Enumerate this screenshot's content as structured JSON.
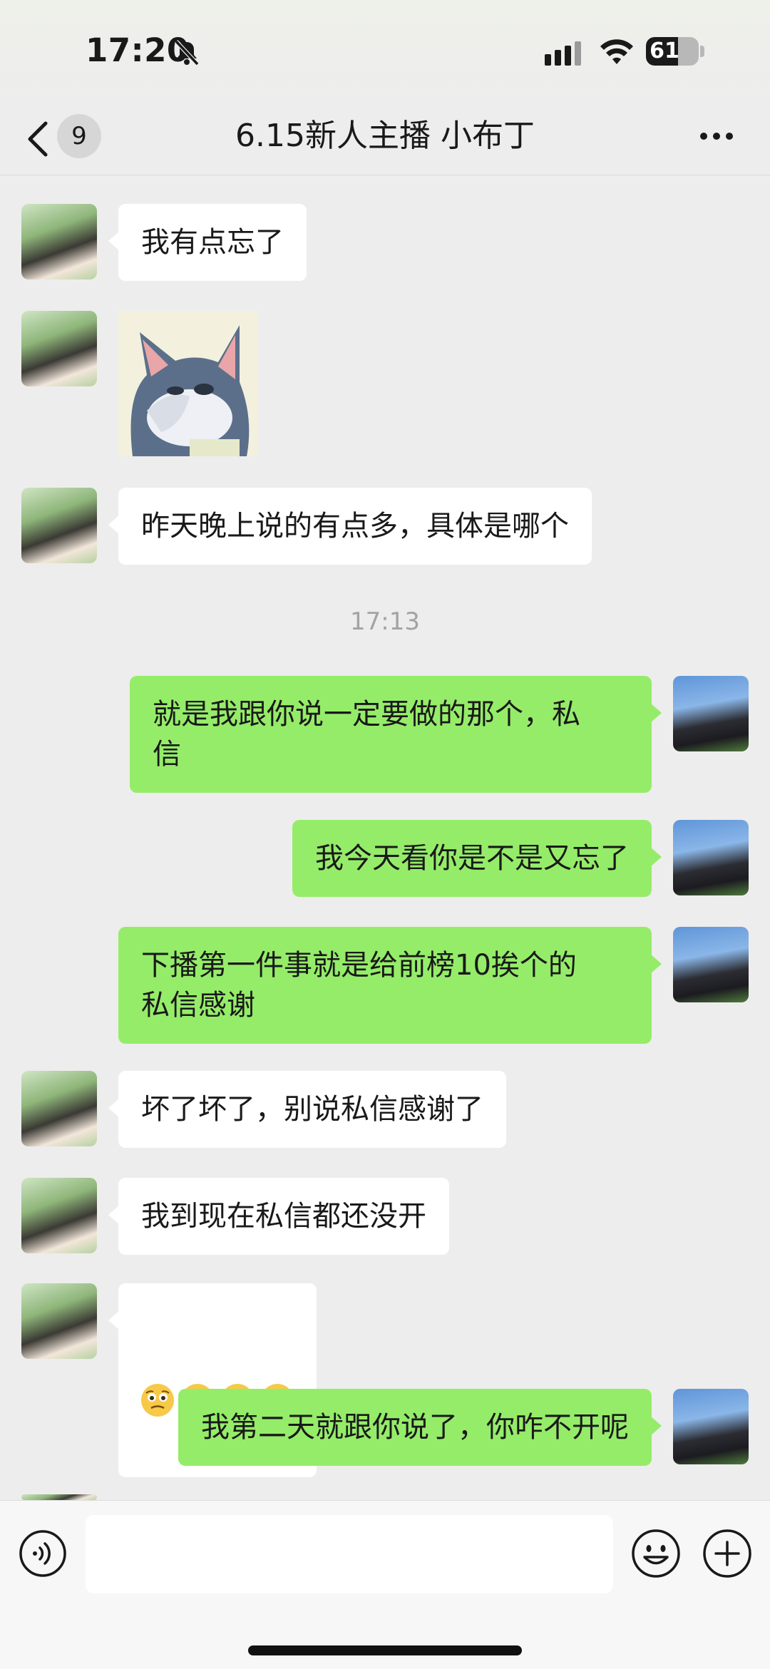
{
  "status_bar": {
    "time": "17:20",
    "battery": "61",
    "battery_level": 0.61
  },
  "header": {
    "unread_count": "9",
    "title": "6.15新人主播  小布丁"
  },
  "timestamp": "17:13",
  "messages": [
    {
      "from": "her",
      "type": "text",
      "text": "我有点忘了"
    },
    {
      "from": "her",
      "type": "sticker",
      "icon": "tom-cat-sticker"
    },
    {
      "from": "her",
      "type": "text",
      "text": "昨天晚上说的有点多，具体是哪个"
    },
    {
      "from": "me",
      "type": "text",
      "text": "就是我跟你说一定要做的那个，私\n信"
    },
    {
      "from": "me",
      "type": "text",
      "text": "我今天看你是不是又忘了"
    },
    {
      "from": "me",
      "type": "text",
      "text": "下播第一件事就是给前榜10挨个的\n私信感谢"
    },
    {
      "from": "her",
      "type": "text",
      "text": "坏了坏了，别说私信感谢了"
    },
    {
      "from": "her",
      "type": "text",
      "text": "我到现在私信都还没开"
    },
    {
      "from": "her",
      "type": "emoji",
      "icon": "pleading-face-emoji",
      "count": 4
    },
    {
      "from": "me",
      "type": "text",
      "text": "我第二天就跟你说了，你咋不开呢"
    }
  ],
  "input_bar": {
    "value": "",
    "voice_icon": "voice-icon",
    "emoji_icon": "emoji-icon",
    "plus_icon": "plus-icon"
  }
}
